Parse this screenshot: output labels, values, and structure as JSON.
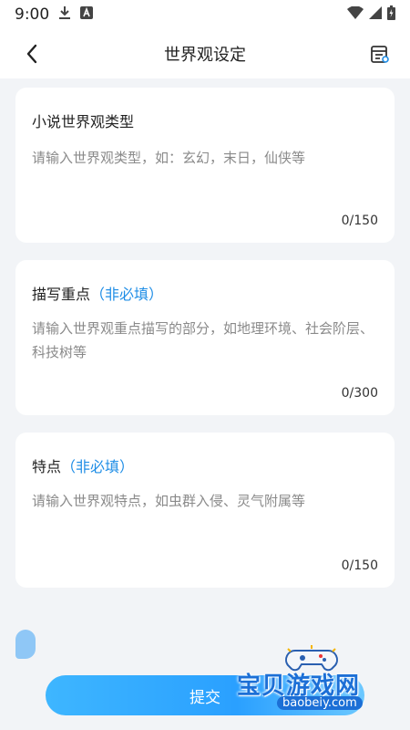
{
  "status_bar": {
    "time": "9:00",
    "icons": [
      "download-icon",
      "a-icon",
      "wifi-icon",
      "signal-icon",
      "battery-icon"
    ]
  },
  "app_bar": {
    "title": "世界观设定",
    "back_icon": "chevron-left-icon",
    "menu_icon": "document-list-icon"
  },
  "cards": [
    {
      "label": "小说世界观类型",
      "optional": "",
      "placeholder": "请输入世界观类型，如：玄幻，末日，仙侠等",
      "counter": "0/150"
    },
    {
      "label": "描写重点",
      "optional": "（非必填）",
      "placeholder": "请输入世界观重点描写的部分，如地理环境、社会阶层、科技树等",
      "counter": "0/300"
    },
    {
      "label": "特点",
      "optional": "（非必填）",
      "placeholder": "请输入世界观特点，如虫群入侵、灵气附属等",
      "counter": "0/150"
    }
  ],
  "submit": {
    "label": "提交"
  },
  "watermark": {
    "title": "宝贝游戏网",
    "url": "baobeiy.com"
  },
  "colors": {
    "accent": "#1e8de6",
    "button": "#2aa0ff",
    "background": "#f2f4f7"
  }
}
